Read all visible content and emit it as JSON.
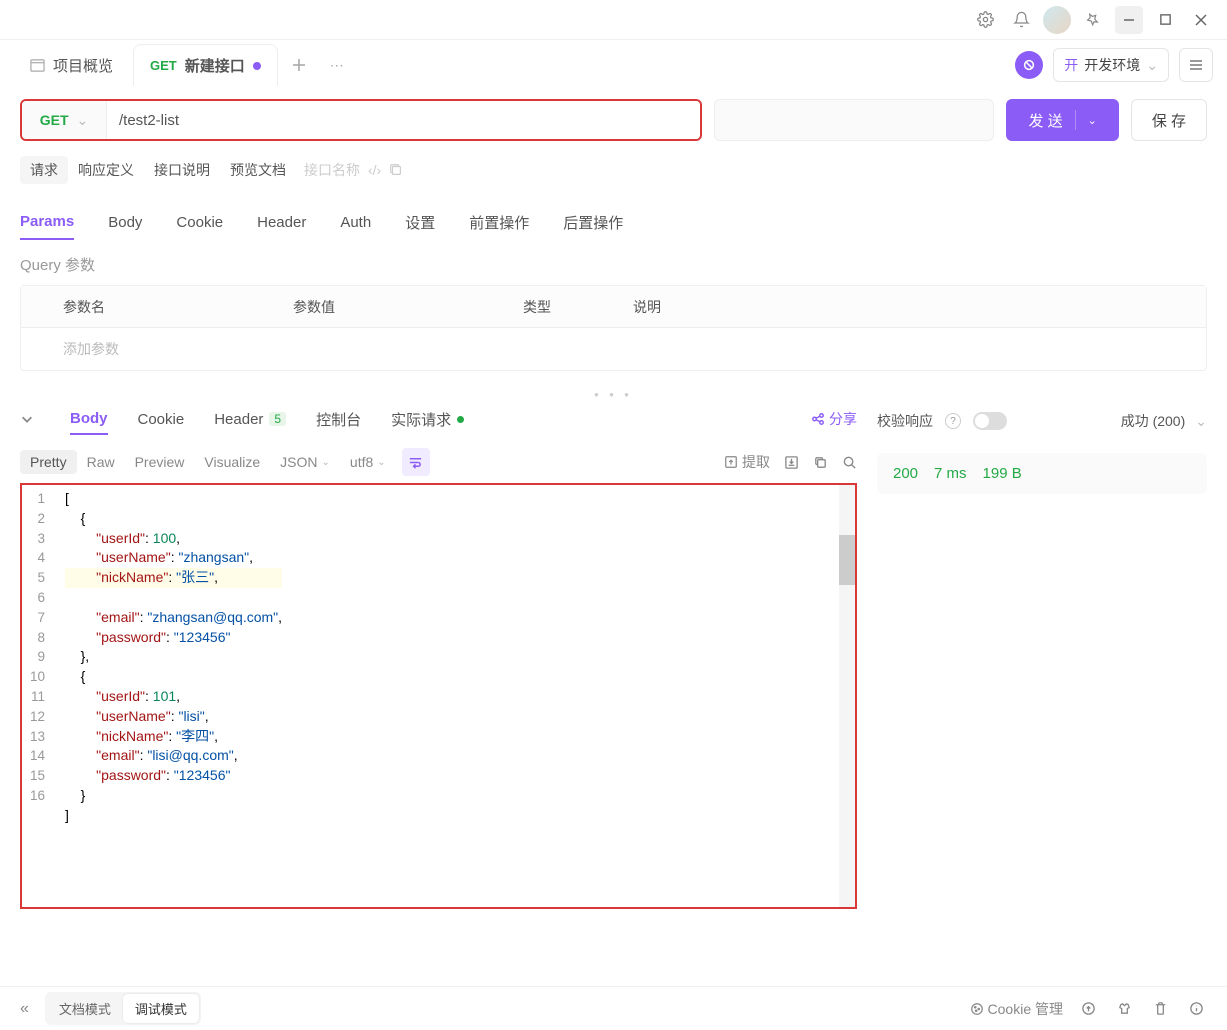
{
  "window": {},
  "tabs": {
    "overview": "项目概览",
    "active": {
      "method": "GET",
      "title": "新建接口"
    }
  },
  "env": {
    "tag": "开",
    "label": "开发环境"
  },
  "request": {
    "method": "GET",
    "url": "/test2-list",
    "send_label": "发 送",
    "save_label": "保 存"
  },
  "subtabs": {
    "request": "请求",
    "response_def": "响应定义",
    "interface_doc": "接口说明",
    "preview_doc": "预览文档",
    "name_placeholder": "接口名称"
  },
  "paramtabs": {
    "params": "Params",
    "body": "Body",
    "cookie": "Cookie",
    "header": "Header",
    "auth": "Auth",
    "settings": "设置",
    "preop": "前置操作",
    "postop": "后置操作"
  },
  "query": {
    "title": "Query 参数",
    "cols": {
      "name": "参数名",
      "value": "参数值",
      "type": "类型",
      "desc": "说明"
    },
    "add_placeholder": "添加参数"
  },
  "response": {
    "tabs": {
      "body": "Body",
      "cookie": "Cookie",
      "header": "Header",
      "header_count": "5",
      "console": "控制台",
      "actual_request": "实际请求"
    },
    "share": "分享",
    "view": {
      "pretty": "Pretty",
      "raw": "Raw",
      "preview": "Preview",
      "visualize": "Visualize",
      "json": "JSON",
      "encoding": "utf8",
      "extract": "提取"
    },
    "body_data": [
      {
        "userId": 100,
        "userName": "zhangsan",
        "nickName": "张三",
        "email": "zhangsan@qq.com",
        "password": "123456"
      },
      {
        "userId": 101,
        "userName": "lisi",
        "nickName": "李四",
        "email": "lisi@qq.com",
        "password": "123456"
      }
    ]
  },
  "validate": {
    "label": "校验响应",
    "success": "成功 (200)"
  },
  "status": {
    "code": "200",
    "time": "7 ms",
    "size": "199 B"
  },
  "bottom": {
    "doc_mode": "文档模式",
    "debug_mode": "调试模式",
    "cookie_mgr": "Cookie 管理"
  }
}
